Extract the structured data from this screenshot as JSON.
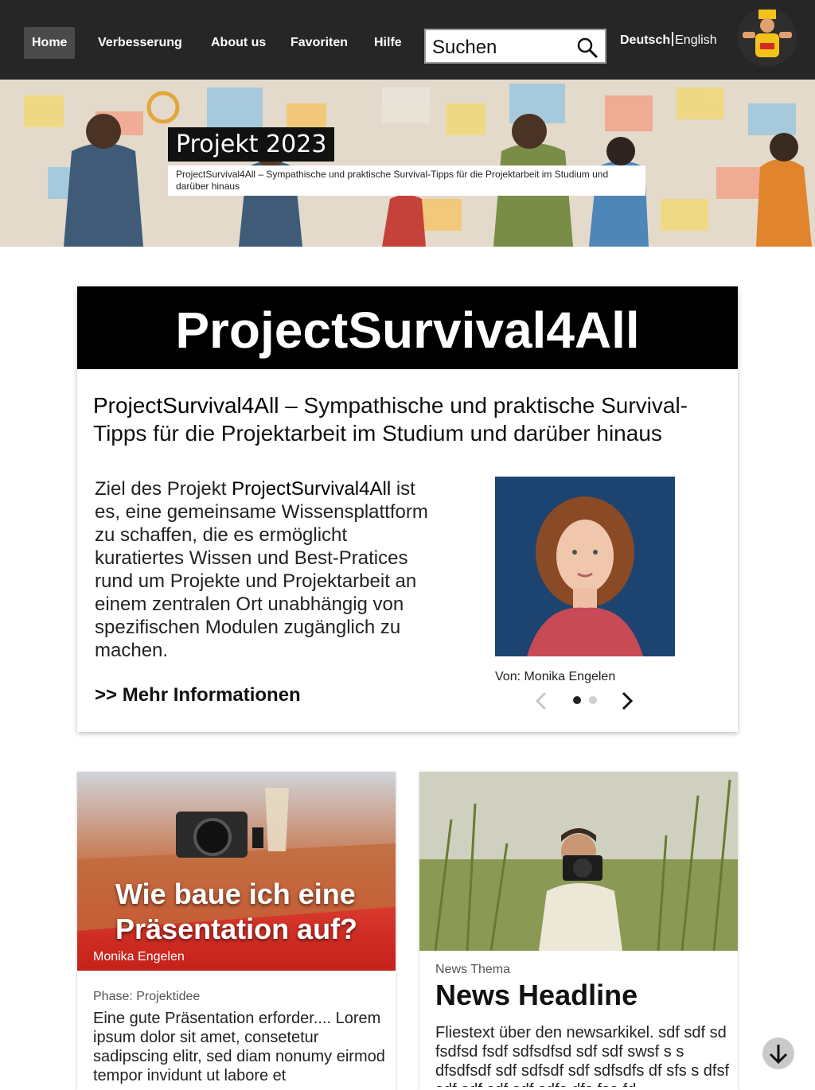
{
  "nav": {
    "items": [
      {
        "label": "Home",
        "active": true
      },
      {
        "label": "Verbesserung"
      },
      {
        "label": "About us"
      },
      {
        "label": "Favoriten"
      },
      {
        "label": "Hilfe"
      }
    ],
    "search": {
      "value": "Suchen"
    },
    "lang": {
      "current": "Deutsch",
      "other": "English"
    }
  },
  "hero": {
    "title": "Projekt 2023",
    "subtitle": "ProjectSurvival4All – Sympathische und praktische Survival-Tipps für die Projektarbeit im Studium und darüber hinaus"
  },
  "main": {
    "heading": "ProjectSurvival4All",
    "sub_brand": "ProjectSurvival4All",
    "sub_rest": " – Sympathische und praktische Survival-Tipps für die Projektarbeit im Studium und darüber hinaus",
    "body_pre": "Ziel des Projekt ",
    "body_brand": "ProjectSurvival4All",
    "body_post": " ist es, eine gemeinsame Wissensplattform zu schaffen, die es ermöglicht kuratiertes Wissen und Best-Pratices rund um Projekte und Projektarbeit an einem zentralen Ort unabhängig von spezifischen Modulen zugänglich zu machen.",
    "more": ">> Mehr Informationen",
    "caption": "Von: Monika Engelen",
    "slider": {
      "count": 2,
      "active": 1
    }
  },
  "tiles": {
    "first": {
      "title": "Wie baue ich eine Präsentation auf?",
      "author": "Monika Engelen",
      "phase": "Phase: Projektidee",
      "text": "Eine gute Präsentation erforder.... Lorem ipsum dolor sit amet, consetetur sadipscing elitr, sed diam nonumy eirmod tempor invidunt ut labore et"
    },
    "second": {
      "topic": "News Thema",
      "headline": "News Headline",
      "text": "Fliestext über den newsarkikel. sdf sdf sd fsdfsd fsdf sdfsdfsd sdf sdf swsf s s dfsdfsdf sdf sdfsdf sdf sdfsdfs df sfs s dfsf sdf sdf sdf sdf sdfs dfs fsa fd"
    }
  },
  "colors": {
    "nav_bg": "#262626",
    "accent_red": "#d42c22",
    "card_head": "#000000"
  },
  "icons": [
    "search-icon",
    "avatar",
    "chevron-left-icon",
    "chevron-right-icon",
    "arrow-down-icon"
  ]
}
